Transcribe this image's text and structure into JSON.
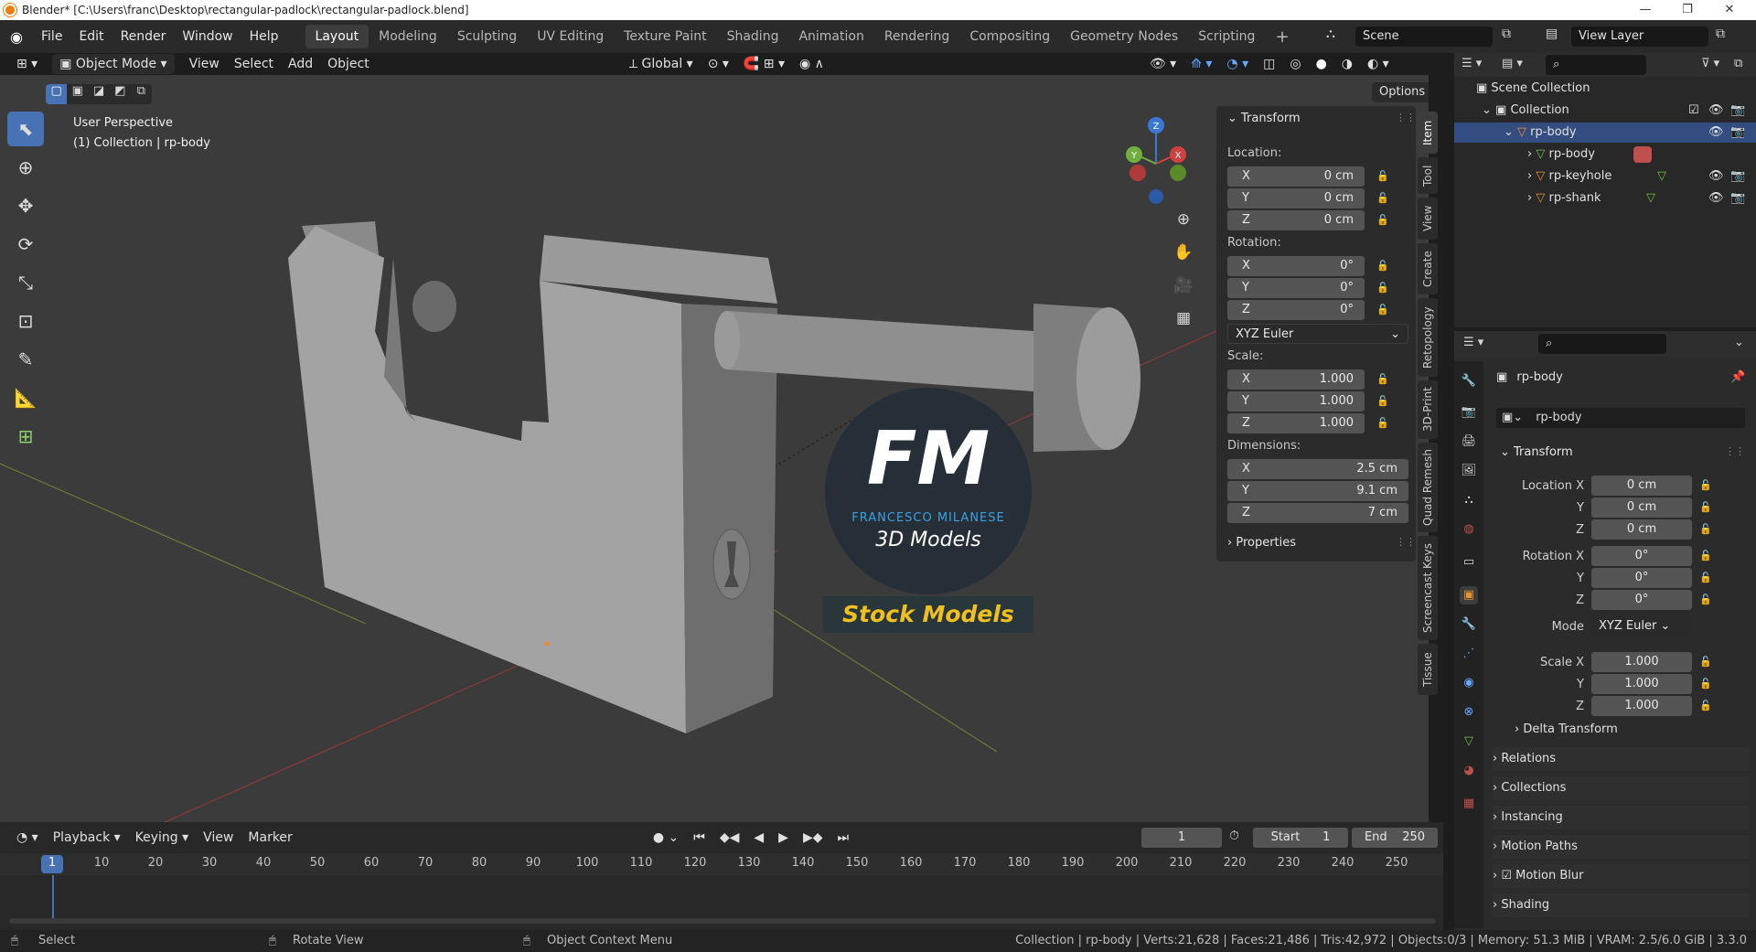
{
  "window": {
    "title": "Blender* [C:\\Users\\franc\\Desktop\\rectangular-padlock\\rectangular-padlock.blend]",
    "minimize": "—",
    "maximize": "❐",
    "close": "✕"
  },
  "menu": {
    "items": [
      "File",
      "Edit",
      "Render",
      "Window",
      "Help"
    ]
  },
  "workspaces": [
    "Layout",
    "Modeling",
    "Sculpting",
    "UV Editing",
    "Texture Paint",
    "Shading",
    "Animation",
    "Rendering",
    "Compositing",
    "Geometry Nodes",
    "Scripting"
  ],
  "scene_name": "Scene",
  "view_layer": "View Layer",
  "viewport_header": {
    "mode": "Object Mode",
    "menus": [
      "View",
      "Select",
      "Add",
      "Object"
    ],
    "orientation": "Global",
    "options": "Options"
  },
  "viewport": {
    "perspective": "User Perspective",
    "context": "(1) Collection | rp-body"
  },
  "watermark": {
    "logo": "FM",
    "brand": "FRANCESCO MILANESE",
    "line2": "3D Models",
    "badge": "Stock Models"
  },
  "npanel": {
    "header": "Transform",
    "location_label": "Location:",
    "rotation_label": "Rotation:",
    "scale_label": "Scale:",
    "dimensions_label": "Dimensions:",
    "location": [
      {
        "axis": "X",
        "value": "0 cm"
      },
      {
        "axis": "Y",
        "value": "0 cm"
      },
      {
        "axis": "Z",
        "value": "0 cm"
      }
    ],
    "rotation": [
      {
        "axis": "X",
        "value": "0°"
      },
      {
        "axis": "Y",
        "value": "0°"
      },
      {
        "axis": "Z",
        "value": "0°"
      }
    ],
    "rotation_mode": "XYZ Euler",
    "scale": [
      {
        "axis": "X",
        "value": "1.000"
      },
      {
        "axis": "Y",
        "value": "1.000"
      },
      {
        "axis": "Z",
        "value": "1.000"
      }
    ],
    "dimensions": [
      {
        "axis": "X",
        "value": "2.5 cm"
      },
      {
        "axis": "Y",
        "value": "9.1 cm"
      },
      {
        "axis": "Z",
        "value": "7 cm"
      }
    ],
    "properties": "Properties"
  },
  "sidebar_tabs": [
    "Item",
    "Tool",
    "View",
    "Create",
    "Retopology",
    "3D-Print",
    "Quad Remesh",
    "Screencast Keys",
    "Tissue"
  ],
  "outliner": {
    "scene_collection": "Scene Collection",
    "collection": "Collection",
    "items": [
      {
        "name": "rp-body"
      },
      {
        "name": "rp-body"
      },
      {
        "name": "rp-keyhole"
      },
      {
        "name": "rp-shank"
      }
    ]
  },
  "properties": {
    "object_name": "rp-body",
    "data_name": "rp-body",
    "transform_header": "Transform",
    "location_label": "Location X",
    "rotation_label": "Rotation X",
    "scale_label": "Scale X",
    "y": "Y",
    "z": "Z",
    "mode_label": "Mode",
    "mode_value": "XYZ Euler",
    "location": [
      "0 cm",
      "0 cm",
      "0 cm"
    ],
    "rotation": [
      "0°",
      "0°",
      "0°"
    ],
    "scale": [
      "1.000",
      "1.000",
      "1.000"
    ],
    "sections": [
      "Delta Transform",
      "Relations",
      "Collections",
      "Instancing",
      "Motion Paths",
      "Motion Blur",
      "Shading"
    ]
  },
  "timeline": {
    "menus": [
      "Playback",
      "Keying",
      "View",
      "Marker"
    ],
    "current_frame": "1",
    "start_label": "Start",
    "start": "1",
    "end_label": "End",
    "end": "250",
    "ruler": [
      "1",
      "10",
      "20",
      "30",
      "40",
      "50",
      "60",
      "70",
      "80",
      "90",
      "100",
      "110",
      "120",
      "130",
      "140",
      "150",
      "160",
      "170",
      "180",
      "190",
      "200",
      "210",
      "220",
      "230",
      "240",
      "250"
    ]
  },
  "statusbar": {
    "select": "Select",
    "rotate": "Rotate View",
    "context_menu": "Object Context Menu",
    "stats": "Collection | rp-body | Verts:21,628 | Faces:21,486 | Tris:42,972 | Objects:0/3 | Memory: 51.3 MiB | VRAM: 2.5/6.0 GiB | 3.3.0"
  },
  "colors": {
    "accent": "#4772b3",
    "object_orange": "#e89030",
    "mesh_green": "#6fbf45",
    "brand_blue": "#3aa0e0",
    "badge_yellow": "#f0c020"
  }
}
